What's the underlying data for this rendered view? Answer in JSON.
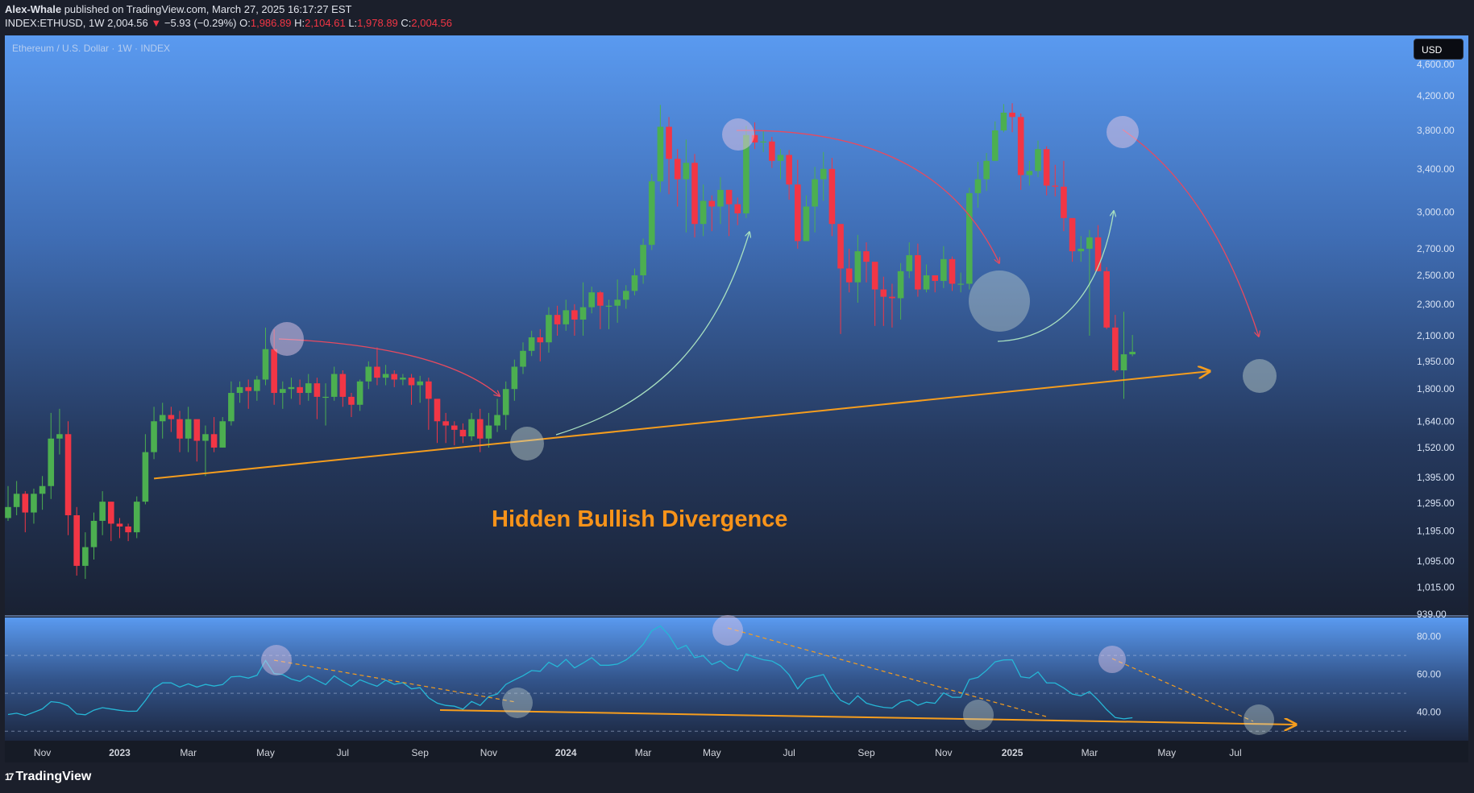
{
  "header": {
    "author": "Alex-Whale",
    "published": " published on TradingView.com, March 27, 2025 16:17:27 EST",
    "symbol": "INDEX:ETHUSD, 1W",
    "last": "2,004.56",
    "change_arrow": "▼",
    "change": "−5.93 (−0.29%)",
    "o_label": "O:",
    "o": "1,986.89",
    "h_label": "H:",
    "h": "2,104.61",
    "l_label": "L:",
    "l": "1,978.89",
    "c_label": "C:",
    "c": "2,004.56"
  },
  "pane_title": "Ethereum / U.S. Dollar · 1W · INDEX",
  "currency_button": "USD",
  "annotation_text": "Hidden Bullish Divergence",
  "logo": {
    "icon": "17",
    "text": "TradingView"
  },
  "colors": {
    "up": "#4caf50",
    "down": "#f23645",
    "orange": "#f59d1e",
    "rsi_line": "#26b7d6",
    "annotation": "#f7931a"
  },
  "chart_data": [
    {
      "type": "candlestick",
      "title": "Ethereum / U.S. Dollar · 1W · INDEX",
      "y_scale": "log",
      "ylim": [
        939,
        5000
      ],
      "y_ticks": [
        939,
        1015,
        1095,
        1195,
        1295,
        1395,
        1520,
        1640,
        1800,
        1950,
        2100,
        2300,
        2500,
        2700,
        3000,
        3400,
        3800,
        4200,
        4600
      ],
      "y_tick_labels": [
        "939.00",
        "1,015.00",
        "1,095.00",
        "1,195.00",
        "1,295.00",
        "1,395.00",
        "1,520.00",
        "1,640.00",
        "1,800.00",
        "1,950.00",
        "2,100.00",
        "2,300.00",
        "2,500.00",
        "2,700.00",
        "3,000.00",
        "3,400.00",
        "3,800.00",
        "4,200.00",
        "4,600.00"
      ],
      "x_ticks": [
        {
          "label": "Nov",
          "week": 4
        },
        {
          "label": "2023",
          "week": 13
        },
        {
          "label": "Mar",
          "week": 21
        },
        {
          "label": "May",
          "week": 30
        },
        {
          "label": "Jul",
          "week": 39
        },
        {
          "label": "Sep",
          "week": 48
        },
        {
          "label": "Nov",
          "week": 56
        },
        {
          "label": "2024",
          "week": 65
        },
        {
          "label": "Mar",
          "week": 74
        },
        {
          "label": "May",
          "week": 82
        },
        {
          "label": "Jul",
          "week": 91
        },
        {
          "label": "Sep",
          "week": 100
        },
        {
          "label": "Nov",
          "week": 109
        },
        {
          "label": "2025",
          "week": 117
        },
        {
          "label": "Mar",
          "week": 126
        },
        {
          "label": "May",
          "week": 135
        },
        {
          "label": "Jul",
          "week": 143
        }
      ],
      "x_bold": [
        "2023",
        "2024",
        "2025"
      ],
      "closes": [
        1280,
        1330,
        1260,
        1330,
        1360,
        1560,
        1580,
        1250,
        1080,
        1140,
        1230,
        1300,
        1220,
        1210,
        1190,
        1300,
        1500,
        1640,
        1670,
        1650,
        1560,
        1650,
        1550,
        1580,
        1520,
        1640,
        1780,
        1810,
        1790,
        1850,
        2020,
        1780,
        1800,
        1810,
        1780,
        1830,
        1760,
        1760,
        1880,
        1760,
        1720,
        1840,
        1920,
        1860,
        1880,
        1850,
        1860,
        1820,
        1840,
        1750,
        1640,
        1620,
        1600,
        1570,
        1650,
        1560,
        1620,
        1670,
        1800,
        1920,
        2010,
        2090,
        2060,
        2230,
        2170,
        2260,
        2200,
        2280,
        2380,
        2290,
        2290,
        2330,
        2390,
        2500,
        2730,
        3280,
        3840,
        3500,
        3300,
        3460,
        2900,
        3100,
        3050,
        3200,
        3070,
        2990,
        3750,
        3670,
        3680,
        3480,
        3540,
        3250,
        2760,
        3050,
        3300,
        3400,
        2900,
        2550,
        2450,
        2680,
        2600,
        2400,
        2350,
        2340,
        2530,
        2650,
        2400,
        2500,
        2460,
        2620,
        2440,
        2440,
        3170,
        3300,
        3480,
        3800,
        4000,
        3950,
        3340,
        3380,
        3600,
        3240,
        3230,
        2950,
        2680,
        2700,
        2790,
        2530,
        2150,
        1900,
        1990,
        2004.56
      ],
      "hilos": [
        [
          1230,
          1360
        ],
        [
          1250,
          1380
        ],
        [
          1190,
          1340
        ],
        [
          1220,
          1350
        ],
        [
          1270,
          1400
        ],
        [
          1310,
          1680
        ],
        [
          1490,
          1700
        ],
        [
          1180,
          1640
        ],
        [
          1050,
          1280
        ],
        [
          1040,
          1190
        ],
        [
          1100,
          1260
        ],
        [
          1180,
          1340
        ],
        [
          1160,
          1300
        ],
        [
          1170,
          1240
        ],
        [
          1160,
          1220
        ],
        [
          1170,
          1320
        ],
        [
          1290,
          1580
        ],
        [
          1470,
          1710
        ],
        [
          1560,
          1730
        ],
        [
          1590,
          1710
        ],
        [
          1500,
          1690
        ],
        [
          1500,
          1710
        ],
        [
          1460,
          1640
        ],
        [
          1400,
          1620
        ],
        [
          1500,
          1660
        ],
        [
          1520,
          1660
        ],
        [
          1620,
          1840
        ],
        [
          1730,
          1840
        ],
        [
          1700,
          1850
        ],
        [
          1740,
          1870
        ],
        [
          1820,
          2150
        ],
        [
          1720,
          2140
        ],
        [
          1700,
          1840
        ],
        [
          1750,
          1860
        ],
        [
          1720,
          1850
        ],
        [
          1740,
          1880
        ],
        [
          1650,
          1860
        ],
        [
          1620,
          1830
        ],
        [
          1740,
          1920
        ],
        [
          1710,
          1900
        ],
        [
          1660,
          1780
        ],
        [
          1690,
          1850
        ],
        [
          1800,
          1950
        ],
        [
          1820,
          2030
        ],
        [
          1820,
          1930
        ],
        [
          1810,
          1900
        ],
        [
          1820,
          1880
        ],
        [
          1720,
          1880
        ],
        [
          1730,
          1870
        ],
        [
          1600,
          1860
        ],
        [
          1540,
          1740
        ],
        [
          1540,
          1680
        ],
        [
          1530,
          1640
        ],
        [
          1540,
          1630
        ],
        [
          1550,
          1680
        ],
        [
          1500,
          1700
        ],
        [
          1520,
          1680
        ],
        [
          1590,
          1750
        ],
        [
          1600,
          1840
        ],
        [
          1740,
          1960
        ],
        [
          1880,
          2060
        ],
        [
          1980,
          2130
        ],
        [
          1950,
          2140
        ],
        [
          2000,
          2280
        ],
        [
          2100,
          2290
        ],
        [
          2130,
          2330
        ],
        [
          2100,
          2300
        ],
        [
          2100,
          2450
        ],
        [
          2240,
          2420
        ],
        [
          2140,
          2390
        ],
        [
          2140,
          2330
        ],
        [
          2180,
          2470
        ],
        [
          2270,
          2430
        ],
        [
          2360,
          2550
        ],
        [
          2440,
          2780
        ],
        [
          2690,
          3350
        ],
        [
          3180,
          4090
        ],
        [
          3160,
          3950
        ],
        [
          3050,
          3600
        ],
        [
          2830,
          3700
        ],
        [
          2790,
          3550
        ],
        [
          2800,
          3250
        ],
        [
          2840,
          3150
        ],
        [
          2900,
          3320
        ],
        [
          2800,
          3200
        ],
        [
          2890,
          3130
        ],
        [
          2950,
          3850
        ],
        [
          3600,
          3890
        ],
        [
          3570,
          3800
        ],
        [
          3410,
          3730
        ],
        [
          3300,
          3600
        ],
        [
          3110,
          3590
        ],
        [
          2700,
          3490
        ],
        [
          2810,
          3150
        ],
        [
          2830,
          3420
        ],
        [
          3100,
          3570
        ],
        [
          2800,
          3510
        ],
        [
          2110,
          2880
        ],
        [
          2380,
          2700
        ],
        [
          2310,
          2810
        ],
        [
          2450,
          2750
        ],
        [
          2160,
          2550
        ],
        [
          2160,
          2490
        ],
        [
          2150,
          2440
        ],
        [
          2200,
          2590
        ],
        [
          2480,
          2750
        ],
        [
          2350,
          2740
        ],
        [
          2380,
          2580
        ],
        [
          2380,
          2500
        ],
        [
          2410,
          2720
        ],
        [
          2390,
          2640
        ],
        [
          2380,
          2520
        ],
        [
          2400,
          3220
        ],
        [
          3040,
          3470
        ],
        [
          3190,
          3560
        ],
        [
          3500,
          3900
        ],
        [
          3780,
          4100
        ],
        [
          3780,
          4110
        ],
        [
          3200,
          3990
        ],
        [
          3240,
          3480
        ],
        [
          3320,
          3690
        ],
        [
          3150,
          3630
        ],
        [
          3140,
          3440
        ],
        [
          2840,
          3480
        ],
        [
          2600,
          2900
        ],
        [
          2600,
          2800
        ],
        [
          2100,
          2850
        ],
        [
          2530,
          2890
        ],
        [
          2140,
          2560
        ],
        [
          1890,
          2230
        ],
        [
          1750,
          2250
        ],
        [
          1978.89,
          2104.61
        ]
      ],
      "trendline": {
        "from": [
          17,
          1390
        ],
        "to": [
          140,
          1895
        ]
      },
      "annotation": "Hidden Bullish Divergence"
    },
    {
      "type": "line",
      "title": "",
      "ylim": [
        25,
        90
      ],
      "y_ticks": [
        40,
        60,
        80
      ],
      "y_tick_labels": [
        "40.00",
        "60.00",
        "80.00"
      ],
      "band": [
        30,
        70
      ],
      "values": [
        38.8,
        39.5,
        38.3,
        40.0,
        41.8,
        45.6,
        45.1,
        43.4,
        39.1,
        38.7,
        41.1,
        42.4,
        41.7,
        41.0,
        40.5,
        40.6,
        46.2,
        52.6,
        55.5,
        55.5,
        53.3,
        55.0,
        53.3,
        54.7,
        53.8,
        54.6,
        58.7,
        59.0,
        58.0,
        59.5,
        67.3,
        60.4,
        59.9,
        57.5,
        56.3,
        59.2,
        56.8,
        54.6,
        59.2,
        56.2,
        53.7,
        57.1,
        55.3,
        53.7,
        56.9,
        54.7,
        55.6,
        52.3,
        53.0,
        47.6,
        44.8,
        43.6,
        43.2,
        41.6,
        45.7,
        43.6,
        48.3,
        49.6,
        54.7,
        57.1,
        59.3,
        62.0,
        61.6,
        66.4,
        64.0,
        67.9,
        63.4,
        66.0,
        68.8,
        64.8,
        64.8,
        65.4,
        67.6,
        71.2,
        75.9,
        83.0,
        85.6,
        80.6,
        73.3,
        75.3,
        68.8,
        69.8,
        65.2,
        67.1,
        63.4,
        61.9,
        70.8,
        69.0,
        67.7,
        67.0,
        64.5,
        59.8,
        52.3,
        57.6,
        58.8,
        59.9,
        51.9,
        46.3,
        44.2,
        48.7,
        44.8,
        43.5,
        42.6,
        42.2,
        45.4,
        46.5,
        43.7,
        45.3,
        44.7,
        50.2,
        47.9,
        47.9,
        57.3,
        58.4,
        62.1,
        66.6,
        67.6,
        67.7,
        58.7,
        58.1,
        61.3,
        55.5,
        55.4,
        52.8,
        49.6,
        48.7,
        50.9,
        46.5,
        41.4,
        37.2,
        36.5,
        37.1
      ]
    }
  ]
}
